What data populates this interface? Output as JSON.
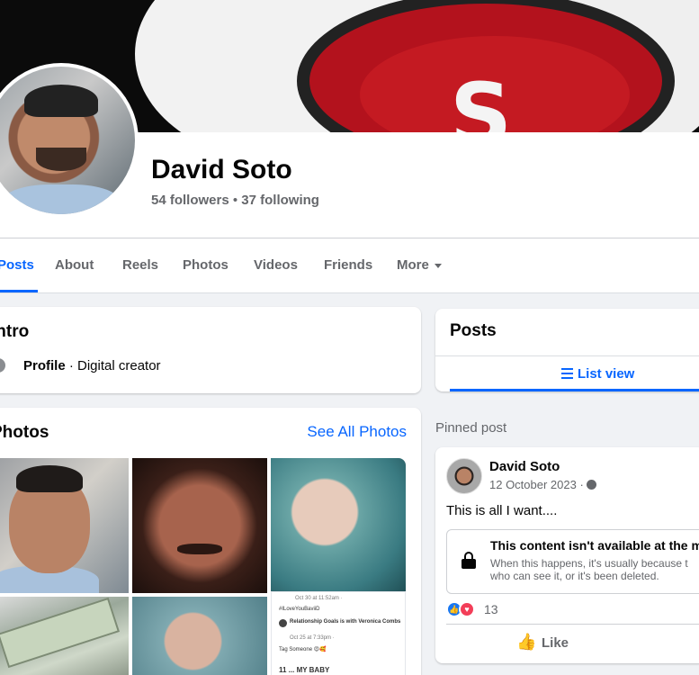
{
  "profile": {
    "name": "David Soto",
    "followers": "54 followers",
    "following": "37 following",
    "separator": " • "
  },
  "cover": {
    "logo_text": "S"
  },
  "tabs": [
    {
      "label": "Posts",
      "active": true
    },
    {
      "label": "About"
    },
    {
      "label": "Reels"
    },
    {
      "label": "Photos"
    },
    {
      "label": "Videos"
    },
    {
      "label": "Friends"
    },
    {
      "label": "More"
    }
  ],
  "intro": {
    "title": "Intro",
    "info_icon": "i",
    "label_bold": "Profile",
    "label_rest": " · Digital creator"
  },
  "photos": {
    "title": "Photos",
    "see_all": "See All Photos",
    "screenshot_text": {
      "time": "Oct 30 at 11:52am · ",
      "tag": "#ILoveYouBaviiD",
      "line": "Relationship Goals is with Veronica Combs",
      "date": "Oct 25 at 7:33pm ·",
      "tag_someone": "Tag Someone 😍🥰",
      "my_baby": "11 ... MY BABY"
    }
  },
  "posts_panel": {
    "title": "Posts",
    "list_view": "List view"
  },
  "pinned": {
    "label": "Pinned post",
    "author": "David Soto",
    "date": "12 October 2023 ·",
    "text": "This is all I want....",
    "unavailable_title": "This content isn't available at the mo",
    "unavailable_desc_1": "When this happens, it's usually because t",
    "unavailable_desc_2": "who can see it, or it's been deleted.",
    "reaction_count": "13",
    "like_label": "Like"
  },
  "icons": {
    "like_reaction": "thumbs-up",
    "love_reaction": "heart",
    "privacy": "globe",
    "lock": "lock",
    "list": "list"
  },
  "colors": {
    "accent": "#0866ff",
    "background": "#f0f2f5",
    "secondary_text": "#65676b"
  }
}
